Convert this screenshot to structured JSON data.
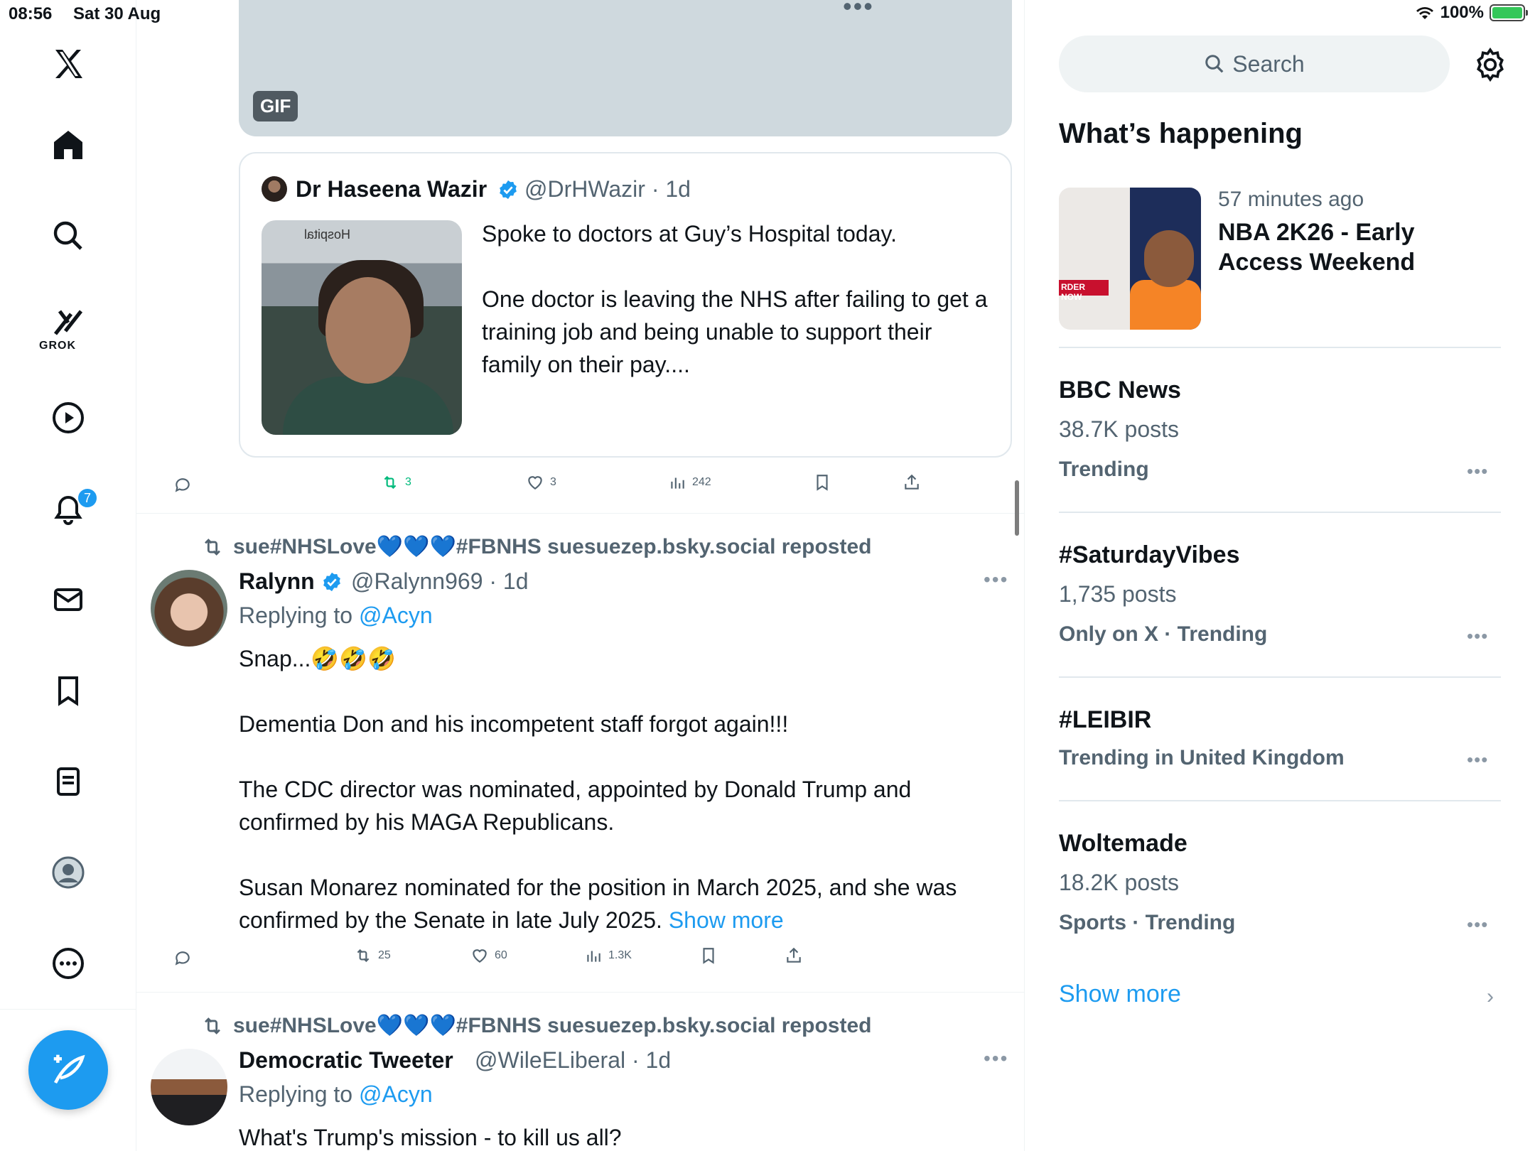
{
  "status_bar": {
    "time": "08:56",
    "date": "Sat 30 Aug",
    "battery": "100%"
  },
  "nav": {
    "items": [
      "x-logo",
      "home-icon",
      "search-icon",
      "grok-icon",
      "video-icon",
      "bell-icon",
      "mail-icon",
      "bookmark-icon",
      "list-icon",
      "profile-icon",
      "more-icon"
    ],
    "grok_label": "GROK",
    "notifications_badge": "7"
  },
  "feed": {
    "gif_label": "GIF",
    "quote": {
      "name": "Dr Haseena Wazir",
      "handle": "@DrHWazir · 1d",
      "media_sign": "Hospital",
      "text": "Spoke to doctors at Guy’s Hospital today.\n\nOne doctor is leaving the NHS after failing to get a training job and being unable to support their family on their pay...."
    },
    "tweet1_actions": {
      "reply": "",
      "repost": "3",
      "like": "3",
      "views": "242"
    },
    "tweets": [
      {
        "reposted_by": "sue#NHSLove💙💙💙#FBNHS suesuezep.bsky.social reposted",
        "name": "Ralynn",
        "handle": "@Ralynn969 · 1d",
        "replying_to_prefix": "Replying to ",
        "replying_to": "@Acyn",
        "text": "Snap...🤣🤣🤣\n\nDementia Don and his incompetent staff forgot again!!!\n\nThe CDC director was nominated, appointed by Donald Trump and confirmed by his MAGA Republicans.\n\nSusan Monarez nominated for the position in March 2025, and she was confirmed by the Senate in late July 2025. ",
        "show_more": "Show more",
        "actions": {
          "repost": "25",
          "like": "60",
          "views": "1.3K"
        }
      },
      {
        "reposted_by": "sue#NHSLove💙💙💙#FBNHS suesuezep.bsky.social reposted",
        "name": "Democratic Tweeter",
        "handle": "@WileELiberal · 1d",
        "replying_to_prefix": "Replying to ",
        "replying_to": "@Acyn",
        "text": "What's Trump's mission - to kill us all?"
      }
    ]
  },
  "sidebar": {
    "search_placeholder": "Search",
    "whats_happening": "What’s happening",
    "nba": {
      "time": "57 minutes ago",
      "title": "NBA 2K26 - Early Access Weekend",
      "img_text": "RDER NOW"
    },
    "trends": [
      {
        "name": "BBC News",
        "count": "38.7K posts",
        "meta": "Trending"
      },
      {
        "name": "#SaturdayVibes",
        "count": "1,735 posts",
        "meta": "Only on X · Trending"
      },
      {
        "name": "#LEIBIR",
        "count": "",
        "meta": "Trending in United Kingdom"
      },
      {
        "name": "Woltemade",
        "count": "18.2K posts",
        "meta": "Sports · Trending"
      }
    ],
    "show_more": "Show more"
  },
  "colors": {
    "accent": "#1d9bf0",
    "repost_green": "#00ba7c",
    "muted": "#536471"
  }
}
